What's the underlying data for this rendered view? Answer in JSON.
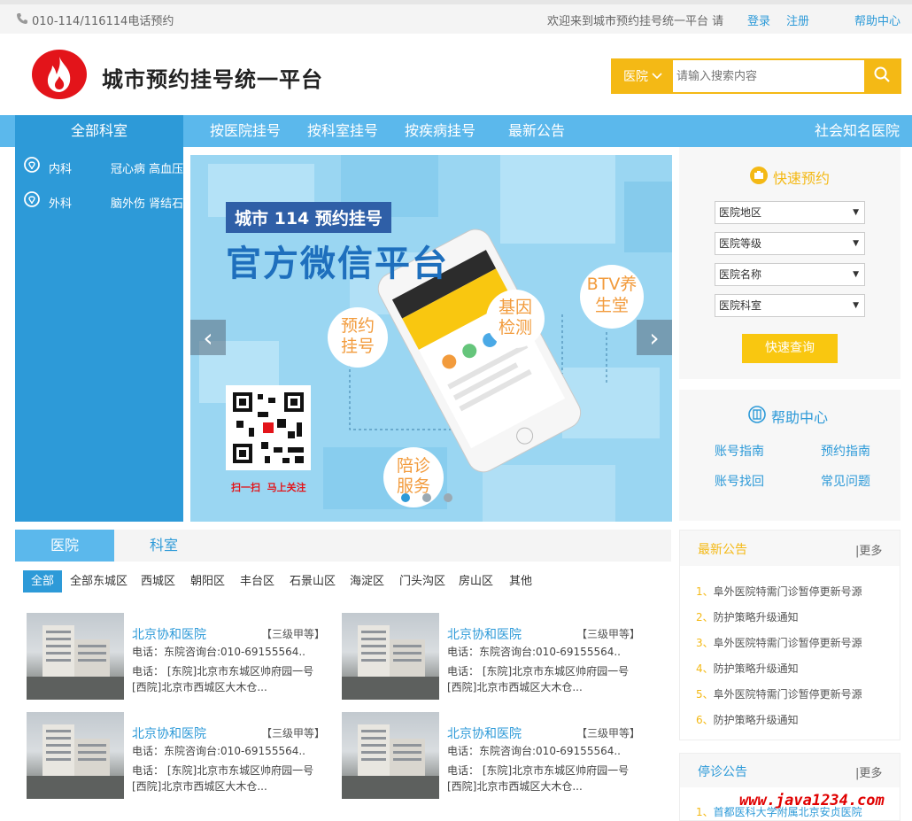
{
  "topbar": {
    "phone": "010-114/116114电话预约",
    "welcome": "欢迎来到城市预约挂号统一平台 请",
    "login": "登录",
    "register": "注册",
    "help": "帮助中心"
  },
  "header": {
    "title": "城市预约挂号统一平台",
    "search": {
      "category": "医院",
      "placeholder": "请输入搜索内容"
    }
  },
  "nav": {
    "all": "全部科室",
    "items": [
      "按医院挂号",
      "按科室挂号",
      "按疾病挂号",
      "最新公告"
    ],
    "right": "社会知名医院"
  },
  "departments": [
    {
      "name": "内科",
      "subs": "冠心病 高血压"
    },
    {
      "name": "外科",
      "subs": "脑外伤 肾结石"
    }
  ],
  "banner": {
    "badge": "城市 114 预约挂号",
    "headline": "官方微信平台",
    "bubbles": [
      "预约挂号",
      "基因检测",
      "BTV养生堂",
      "陪诊服务"
    ],
    "qr_caption": "扫一扫  马上关注",
    "prev": "‹",
    "next": "›"
  },
  "quick": {
    "title": "快速预约",
    "selects": [
      "医院地区",
      "医院等级",
      "医院名称",
      "医院科室"
    ],
    "button": "快速查询"
  },
  "help_center": {
    "title": "帮助中心",
    "links": [
      "账号指南",
      "预约指南",
      "账号找回",
      "常见问题"
    ]
  },
  "hospital_tabs": [
    "医院",
    "科室"
  ],
  "districts": [
    "全部",
    "全部东城区",
    "西城区",
    "朝阳区",
    "丰台区",
    "石景山区",
    "海淀区",
    "门头沟区",
    "房山区",
    "其他"
  ],
  "hospitals": [
    {
      "name": "北京协和医院",
      "grade": "【三级甲等】",
      "tel": "电话：东院咨询台:010-69155564..",
      "addr1": "电话： [东院]北京市东城区帅府园一号",
      "addr2": "[西院]北京市西城区大木仓..."
    },
    {
      "name": "北京协和医院",
      "grade": "【三级甲等】",
      "tel": "电话：东院咨询台:010-69155564..",
      "addr1": "电话： [东院]北京市东城区帅府园一号",
      "addr2": "[西院]北京市西城区大木仓..."
    },
    {
      "name": "北京协和医院",
      "grade": "【三级甲等】",
      "tel": "电话：东院咨询台:010-69155564..",
      "addr1": "电话： [东院]北京市东城区帅府园一号",
      "addr2": "[西院]北京市西城区大木仓..."
    },
    {
      "name": "北京协和医院",
      "grade": "【三级甲等】",
      "tel": "电话：东院咨询台:010-69155564..",
      "addr1": "电话： [东院]北京市东城区帅府园一号",
      "addr2": "[西院]北京市西城区大木仓..."
    }
  ],
  "notices": {
    "title": "最新公告",
    "more": "|更多",
    "items": [
      {
        "num": "1、",
        "text": "阜外医院特需门诊暂停更新号源"
      },
      {
        "num": "2、",
        "text": "防护策略升级通知"
      },
      {
        "num": "3、",
        "text": "阜外医院特需门诊暂停更新号源"
      },
      {
        "num": "4、",
        "text": "防护策略升级通知"
      },
      {
        "num": "5、",
        "text": "阜外医院特需门诊暂停更新号源"
      },
      {
        "num": "6、",
        "text": "防护策略升级通知"
      }
    ]
  },
  "stop_notices": {
    "title": "停诊公告",
    "more": "|更多",
    "items": [
      {
        "num": "1、",
        "text": "首都医科大学附属北京安贞医院"
      }
    ]
  },
  "watermark": "www.java1234.com",
  "colors": {
    "primary": "#2d9ad8",
    "nav": "#5bb8ec",
    "accent": "#f4b915",
    "logo": "#e3141a"
  }
}
